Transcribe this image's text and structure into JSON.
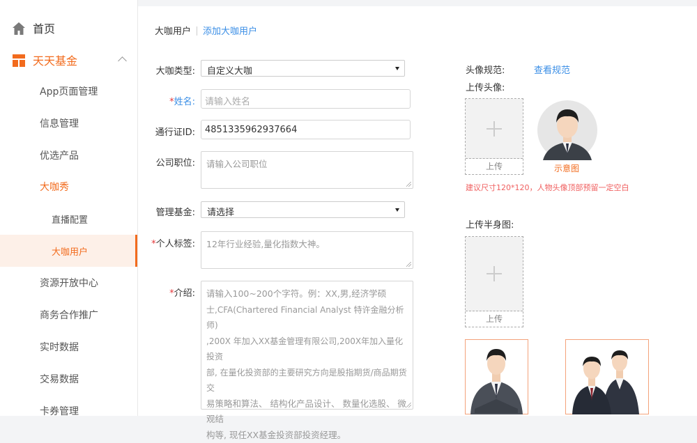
{
  "sidebar": {
    "home": "首页",
    "section": "天天基金",
    "items": [
      {
        "label": "App页面管理"
      },
      {
        "label": "信息管理"
      },
      {
        "label": "优选产品"
      },
      {
        "label": "大咖秀"
      },
      {
        "label": "直播配置"
      },
      {
        "label": "大咖用户"
      },
      {
        "label": "资源开放中心"
      },
      {
        "label": "商务合作推广"
      },
      {
        "label": "实时数据"
      },
      {
        "label": "交易数据"
      },
      {
        "label": "卡券管理"
      }
    ]
  },
  "breadcrumb": {
    "current": "大咖用户",
    "link": "添加大咖用户"
  },
  "form": {
    "type_label": "大咖类型:",
    "type_value": "自定义大咖",
    "name_label": "姓名:",
    "name_placeholder": "请输入姓名",
    "pass_label": "通行证ID:",
    "pass_value": "4851335962937664",
    "position_label": "公司职位:",
    "position_placeholder": "请输入公司职位",
    "fund_label": "管理基金:",
    "fund_value": "请选择",
    "tags_label": "个人标签:",
    "tags_placeholder": "12年行业经验,量化指数大神。",
    "intro_label": "介绍:",
    "intro_placeholder_lines": [
      "请输入100~200个字符。例：XX,男,经济学硕",
      "士,CFA(Chartered Financial Analyst 特许金融分析师)",
      ",200X 年加入XX基金管理有限公司,200X年加入量化投资",
      "部, 在量化投资部的主要研究方向是股指期货/商品期货交",
      "易策略和算法、 结构化产品设计、 数量化选股、 微观结",
      "构等, 现任XX基金投资部投资经理。"
    ]
  },
  "avatar": {
    "spec_label": "头像规范:",
    "spec_link": "查看规范",
    "upload_label": "上传头像:",
    "upload_btn": "上传",
    "sample_caption": "示意图",
    "hint": "建议尺寸120*120，人物头像顶部预留一定空白"
  },
  "half": {
    "upload_label": "上传半身图:",
    "upload_btn": "上传"
  },
  "colors": {
    "accent": "#f26b1d",
    "link": "#3a8ee6",
    "required": "#e4393c"
  }
}
